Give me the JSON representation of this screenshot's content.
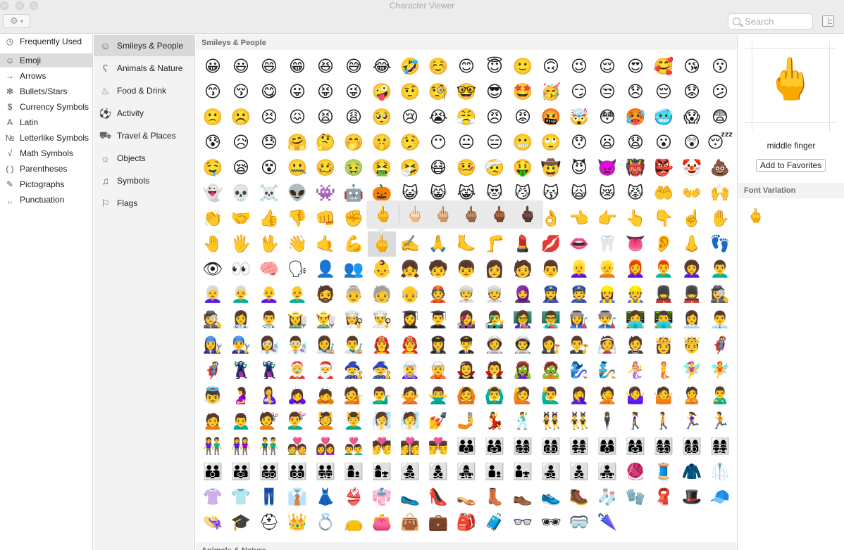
{
  "window": {
    "title": "Character Viewer"
  },
  "search": {
    "placeholder": "Search"
  },
  "sidebar": {
    "items": [
      {
        "label": "Frequently Used",
        "icon": "clock-icon",
        "glyph": "◷"
      },
      {
        "label": "Emoji",
        "icon": "smiley-icon",
        "glyph": "☺",
        "selected": true
      },
      {
        "label": "Arrows",
        "icon": "arrow-icon",
        "glyph": "→"
      },
      {
        "label": "Bullets/Stars",
        "icon": "asterisk-icon",
        "glyph": "✻"
      },
      {
        "label": "Currency Symbols",
        "icon": "dollar-icon",
        "glyph": "$"
      },
      {
        "label": "Latin",
        "icon": "latin-icon",
        "glyph": "A"
      },
      {
        "label": "Letterlike Symbols",
        "icon": "numero-icon",
        "glyph": "№"
      },
      {
        "label": "Math Symbols",
        "icon": "sqrt-icon",
        "glyph": "√"
      },
      {
        "label": "Parentheses",
        "icon": "parentheses-icon",
        "glyph": "( )"
      },
      {
        "label": "Pictographs",
        "icon": "pictograph-icon",
        "glyph": "✎"
      },
      {
        "label": "Punctuation",
        "icon": "punctuation-icon",
        "glyph": ",,"
      }
    ]
  },
  "categories": {
    "items": [
      {
        "label": "Smileys & People",
        "icon": "smiley-icon",
        "glyph": "☺",
        "selected": true
      },
      {
        "label": "Animals & Nature",
        "icon": "bear-icon",
        "glyph": "ʕ"
      },
      {
        "label": "Food & Drink",
        "icon": "food-icon",
        "glyph": "♨"
      },
      {
        "label": "Activity",
        "icon": "ball-icon",
        "glyph": "⚽"
      },
      {
        "label": "Travel & Places",
        "icon": "car-icon",
        "glyph": "⛟"
      },
      {
        "label": "Objects",
        "icon": "bulb-icon",
        "glyph": "☼"
      },
      {
        "label": "Symbols",
        "icon": "symbols-icon",
        "glyph": "♫"
      },
      {
        "label": "Flags",
        "icon": "flag-icon",
        "glyph": "⚐"
      }
    ]
  },
  "main": {
    "section_title": "Smileys & People",
    "next_section_title": "Animals & Nature",
    "selected_index": 139,
    "emojis": [
      "😀",
      "😃",
      "😄",
      "😁",
      "😆",
      "😅",
      "😂",
      "🤣",
      "☺️",
      "😊",
      "😇",
      "🙂",
      "🙃",
      "😉",
      "😌",
      "😍",
      "🥰",
      "😘",
      "😗",
      "😙",
      "😚",
      "😋",
      "😛",
      "😝",
      "😜",
      "🤪",
      "🤨",
      "🧐",
      "🤓",
      "😎",
      "🤩",
      "🥳",
      "😏",
      "😒",
      "😞",
      "😔",
      "😟",
      "😕",
      "🙁",
      "☹️",
      "😣",
      "😖",
      "😫",
      "😩",
      "🥺",
      "😢",
      "😭",
      "😤",
      "😠",
      "😡",
      "🤬",
      "🤯",
      "😳",
      "🥵",
      "🥶",
      "😱",
      "😨",
      "😰",
      "😥",
      "😓",
      "🤗",
      "🤔",
      "🤭",
      "🤫",
      "🤥",
      "😶",
      "😐",
      "😑",
      "😬",
      "🙄",
      "😯",
      "😦",
      "😧",
      "😮",
      "😲",
      "😴",
      "🤤",
      "😪",
      "😵",
      "🤐",
      "🥴",
      "🤢",
      "🤮",
      "🤧",
      "😷",
      "🤒",
      "🤕",
      "🤑",
      "🤠",
      "😈",
      "👿",
      "👹",
      "👺",
      "🤡",
      "💩",
      "👻",
      "💀",
      "☠️",
      "👽",
      "👾",
      "🤖",
      "🎃",
      "😺",
      "😸",
      "😹",
      "😻",
      "😼",
      "😽",
      "🙀",
      "😿",
      "😾",
      "🤲",
      "👐",
      "🙌",
      "👏",
      "🤝",
      "👍",
      "👎",
      "👊",
      "✊",
      "🤛",
      "🤜",
      "🤞",
      "✌️",
      "🤟",
      "🤘",
      "👌",
      "👈",
      "👉",
      "👆",
      "👇",
      "☝️",
      "✋",
      "🤚",
      "🖐",
      "🖖",
      "👋",
      "🤙",
      "💪",
      "🖕",
      "✍️",
      "🙏",
      "🦶",
      "🦵",
      "💄",
      "💋",
      "👄",
      "🦷",
      "👅",
      "👂",
      "👃",
      "👣",
      "👁",
      "👀",
      "🧠",
      "🗣",
      "👤",
      "👥",
      "👶",
      "👧",
      "🧒",
      "👦",
      "👩",
      "🧑",
      "👨",
      "👱‍♀️",
      "👱",
      "👩‍🦰",
      "👨‍🦰",
      "👩‍🦱",
      "👨‍🦱",
      "👩‍🦳",
      "👨‍🦳",
      "👩‍🦲",
      "👨‍🦲",
      "🧔",
      "👵",
      "🧓",
      "👴",
      "👲",
      "👳‍♀️",
      "👳",
      "🧕",
      "👮‍♀️",
      "👮",
      "👷‍♀️",
      "👷",
      "💂‍♀️",
      "💂",
      "🕵️‍♀️",
      "🕵️",
      "👩‍⚕️",
      "👨‍⚕️",
      "👩‍🌾",
      "👨‍🌾",
      "👩‍🍳",
      "👨‍🍳",
      "👩‍🎓",
      "👨‍🎓",
      "👩‍🎤",
      "👨‍🎤",
      "👩‍🏫",
      "👨‍🏫",
      "👩‍🏭",
      "👨‍🏭",
      "👩‍💻",
      "👨‍💻",
      "👩‍💼",
      "👨‍💼",
      "👩‍🔧",
      "👨‍🔧",
      "👩‍🔬",
      "👨‍🔬",
      "👩‍🎨",
      "👨‍🎨",
      "👩‍🚒",
      "👨‍🚒",
      "👩‍✈️",
      "👨‍✈️",
      "👩‍🚀",
      "👨‍🚀",
      "👩‍⚖️",
      "👨‍⚖️",
      "👰",
      "🤵",
      "👸",
      "🤴",
      "🦸‍♀️",
      "🦸",
      "🦹‍♀️",
      "🦹",
      "🤶",
      "🎅",
      "🧙‍♀️",
      "🧙",
      "🧝‍♀️",
      "🧝",
      "🧛‍♀️",
      "🧛",
      "🧟‍♀️",
      "🧟",
      "🧞‍♀️",
      "🧞",
      "🧜‍♀️",
      "🧜",
      "🧚‍♀️",
      "🧚",
      "👼",
      "🤰",
      "🤱",
      "🙇‍♀️",
      "🙇",
      "💁",
      "💁‍♂️",
      "🙅",
      "🙅‍♂️",
      "🙆",
      "🙆‍♂️",
      "🙋",
      "🙋‍♂️",
      "🤦‍♀️",
      "🤦",
      "🤷‍♀️",
      "🤷",
      "🙎",
      "🙎‍♂️",
      "🙍",
      "🙍‍♂️",
      "💇",
      "💇‍♂️",
      "💆",
      "💆‍♂️",
      "🧖‍♀️",
      "🧖",
      "💅",
      "🤳",
      "💃",
      "🕺",
      "👯",
      "👯‍♂️",
      "🕴",
      "🚶‍♀️",
      "🚶",
      "🏃‍♀️",
      "🏃",
      "👫",
      "👭",
      "👬",
      "💑",
      "👩‍❤️‍👩",
      "👨‍❤️‍👨",
      "💏",
      "👩‍❤️‍💋‍👩",
      "👨‍❤️‍💋‍👨",
      "👪",
      "👨‍👩‍👧",
      "👨‍👩‍👧‍👦",
      "👨‍👩‍👦‍👦",
      "👨‍👩‍👧‍👧",
      "👩‍👩‍👦",
      "👩‍👩‍👧",
      "👩‍👩‍👧‍👦",
      "👩‍👩‍👦‍👦",
      "👩‍👩‍👧‍👧",
      "👨‍👨‍👦",
      "👨‍👨‍👧",
      "👨‍👨‍👧‍👦",
      "👨‍👨‍👦‍👦",
      "👨‍👨‍👧‍👧",
      "👩‍👦",
      "👩‍👧",
      "👩‍👧‍👦",
      "👩‍👦‍👦",
      "👩‍👧‍👧",
      "👨‍👦",
      "👨‍👧",
      "👨‍👧‍👦",
      "👨‍👦‍👦",
      "👨‍👧‍👧",
      "🧶",
      "🧵",
      "🧥",
      "🥼",
      "👚",
      "👕",
      "👖",
      "👔",
      "👗",
      "👙",
      "👘",
      "🥿",
      "👠",
      "👡",
      "👢",
      "👞",
      "👟",
      "🥾",
      "🧦",
      "🧤",
      "🧣",
      "🎩",
      "🧢",
      "👒",
      "🎓",
      "⛑",
      "👑",
      "💍",
      "👝",
      "👛",
      "👜",
      "💼",
      "🎒",
      "🧳",
      "👓",
      "🕶",
      "🥽",
      "🌂"
    ]
  },
  "popover": {
    "variants": [
      "🖕",
      "🖕🏻",
      "🖕🏼",
      "🖕🏽",
      "🖕🏾",
      "🖕🏿"
    ]
  },
  "detail": {
    "glyph": "🖕",
    "name": "middle finger",
    "add_favorites": "Add to Favorites",
    "font_variation_title": "Font Variation",
    "font_variations": [
      "🖕"
    ]
  },
  "colors": {
    "selection": "#dcdcdc",
    "sidebar_bg": "#ffffff",
    "category_bg": "#f3f3f3",
    "popover_bg": "#e9e9e9"
  }
}
